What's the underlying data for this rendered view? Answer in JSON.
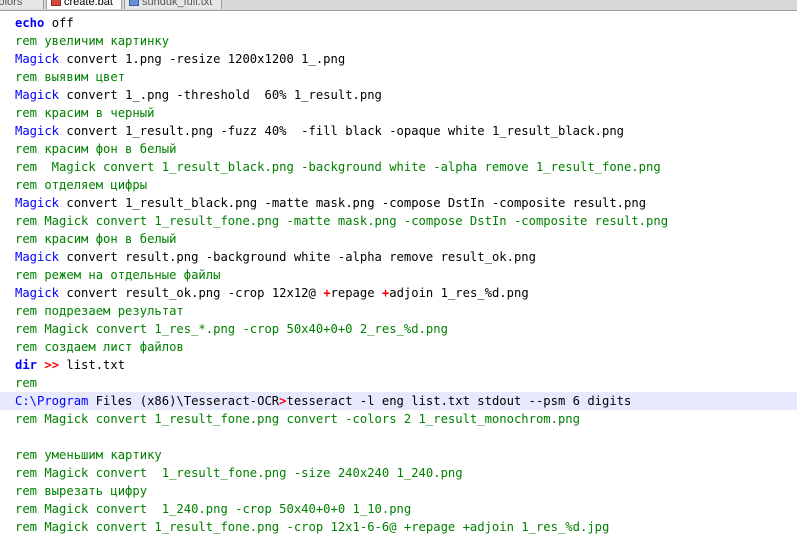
{
  "tabs": [
    {
      "label": "colors",
      "icon": "document-icon"
    },
    {
      "label": "create.bat",
      "icon": "batch-file-icon",
      "active": true
    },
    {
      "label": "sunduk_full.txt",
      "icon": "text-file-icon"
    }
  ],
  "editor": {
    "colors": {
      "keyword": "#0000ff",
      "comment": "#008000",
      "operator": "#ff0000",
      "current_line": "#e8e8ff"
    },
    "lines": [
      {
        "kw": "echo",
        "rest": " off",
        "type": "cmd"
      },
      {
        "text": "rem увеличим картинку",
        "type": "rem"
      },
      {
        "kw": "Magick",
        "rest": " convert 1.png -resize 1200x1200 1_.png",
        "type": "cmd"
      },
      {
        "text": "rem выявим цвет",
        "type": "rem"
      },
      {
        "kw": "Magick",
        "rest": " convert 1_.png -threshold  60% 1_result.png",
        "type": "cmd"
      },
      {
        "text": "rem красим в черный",
        "type": "rem"
      },
      {
        "kw": "Magick",
        "rest": " convert 1_result.png -fuzz 40%  -fill black -opaque white 1_result_black.png",
        "type": "cmd"
      },
      {
        "text": "rem красим фон в белый",
        "type": "rem"
      },
      {
        "text": "rem  Magick convert 1_result_black.png -background white -alpha remove 1_result_fone.png",
        "type": "rem"
      },
      {
        "text": "rem отделяем цифры",
        "type": "rem"
      },
      {
        "kw": "Magick",
        "rest": " convert 1_result_black.png -matte mask.png -compose DstIn -composite result.png",
        "type": "cmd"
      },
      {
        "text": "rem Magick convert 1_result_fone.png -matte mask.png -compose DstIn -composite result.png",
        "type": "rem"
      },
      {
        "text": "rem красим фон в белый",
        "type": "rem"
      },
      {
        "kw": "Magick",
        "rest": " convert result.png -background white -alpha remove result_ok.png",
        "type": "cmd"
      },
      {
        "text": "rem режем на отдельные файлы",
        "type": "rem"
      },
      {
        "kw": "Magick",
        "rest_parts": [
          " convert result_ok.png -crop 12x12@ ",
          "+",
          "repage ",
          "+",
          "adjoin 1_res_%d.png"
        ],
        "type": "cmd_plus"
      },
      {
        "text": "rem подрезаем результат",
        "type": "rem"
      },
      {
        "text": "rem Magick convert 1_res_*.png -crop 50x40+0+0 2_res_%d.png",
        "type": "rem"
      },
      {
        "text": "rem создаем лист файлов",
        "type": "rem"
      },
      {
        "kw": "dir",
        "op": " >>",
        "rest": " list.txt",
        "type": "cmd_op"
      },
      {
        "text": "rem",
        "type": "rem"
      },
      {
        "kw": "C:\\Program",
        "rest": " Files (x86)\\Tesseract-OCR",
        "op": ">",
        "tail": "tesseract -l eng list.txt stdout --psm 6 digits",
        "type": "cmd_path",
        "current": true
      },
      {
        "text": "rem Magick convert 1_result_fone.png convert -colors 2 1_result_monochrom.png",
        "type": "rem"
      },
      {
        "text": "",
        "type": "blank"
      },
      {
        "text": "rem уменьшим картику",
        "type": "rem"
      },
      {
        "text": "rem Magick convert  1_result_fone.png -size 240x240 1_240.png",
        "type": "rem"
      },
      {
        "text": "rem вырезать цифру",
        "type": "rem"
      },
      {
        "text": "rem Magick convert  1_240.png -crop 50x40+0+0 1_10.png",
        "type": "rem"
      },
      {
        "text": "rem Magick convert 1_result_fone.png -crop 12x1-6-6@ +repage +adjoin 1_res_%d.jpg",
        "type": "rem"
      }
    ]
  }
}
